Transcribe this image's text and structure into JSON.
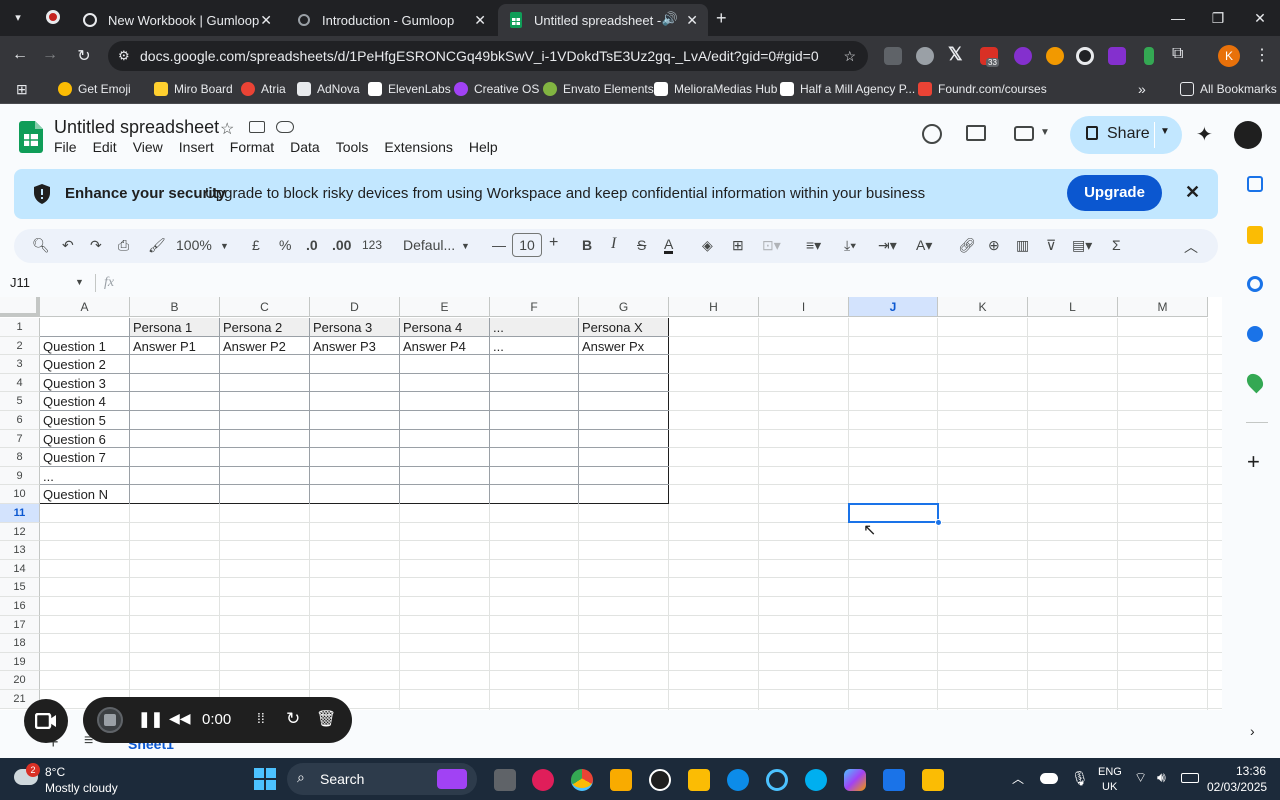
{
  "browser": {
    "tabs": [
      {
        "title": "New Workbook | Gumloop"
      },
      {
        "title": "Introduction - Gumloop"
      },
      {
        "title": "Untitled spreadsheet - Goo"
      }
    ],
    "url": "docs.google.com/spreadsheets/d/1PeHfgESRONCGq49bkSwV_i-1VDokdTsE3Uz2gq-_LvA/edit?gid=0#gid=0",
    "extension_badge": "33",
    "profile_initial": "K",
    "bookmarks": [
      "Get Emoji",
      "Miro Board",
      "Atria",
      "AdNova",
      "ElevenLabs",
      "Creative OS",
      "Envato Elements",
      "MelioraMedias Hub",
      "Half a Mill Agency P...",
      "Foundr.com/courses"
    ],
    "all_bookmarks": "All Bookmarks"
  },
  "sheets": {
    "doc_title": "Untitled spreadsheet",
    "menu": [
      "File",
      "Edit",
      "View",
      "Insert",
      "Format",
      "Data",
      "Tools",
      "Extensions",
      "Help"
    ],
    "share_label": "Share",
    "banner": {
      "title": "Enhance your security",
      "text": "Upgrade to block risky devices from using Workspace and keep confidential information within your business",
      "button": "Upgrade"
    },
    "toolbar": {
      "zoom": "100%",
      "currency": "£",
      "percent": "%",
      "dec_down": ".0",
      "dec_up": ".00",
      "number_format": "123",
      "font": "Defaul...",
      "font_size": "10"
    },
    "name_box": "J11",
    "fx": "fx",
    "columns": [
      "A",
      "B",
      "C",
      "D",
      "E",
      "F",
      "G",
      "H",
      "I",
      "J",
      "K",
      "L",
      "M"
    ],
    "rows": [
      "1",
      "2",
      "3",
      "4",
      "5",
      "6",
      "7",
      "8",
      "9",
      "10",
      "11",
      "12",
      "13",
      "14",
      "15",
      "16",
      "17",
      "18",
      "19",
      "20",
      "21"
    ],
    "cells": {
      "row1": [
        "",
        "Persona 1",
        "Persona 2",
        "Persona 3",
        "Persona 4",
        "...",
        "Persona X"
      ],
      "row2": [
        "Question 1",
        "Answer P1",
        "Answer P2",
        "Answer P3",
        "Answer P4",
        "...",
        "Answer Px"
      ],
      "colA": [
        "Question 2",
        "Question 3",
        "Question 4",
        "Question 5",
        "Question 6",
        "Question 7",
        "...",
        "Question N"
      ]
    },
    "sheet_tab": "Sheet1"
  },
  "recorder": {
    "time": "0:00"
  },
  "taskbar": {
    "weather_temp": "8°C",
    "weather_desc": "Mostly cloudy",
    "weather_badge": "2",
    "search": "Search",
    "lang1": "ENG",
    "lang2": "UK",
    "time": "13:36",
    "date": "02/03/2025"
  }
}
